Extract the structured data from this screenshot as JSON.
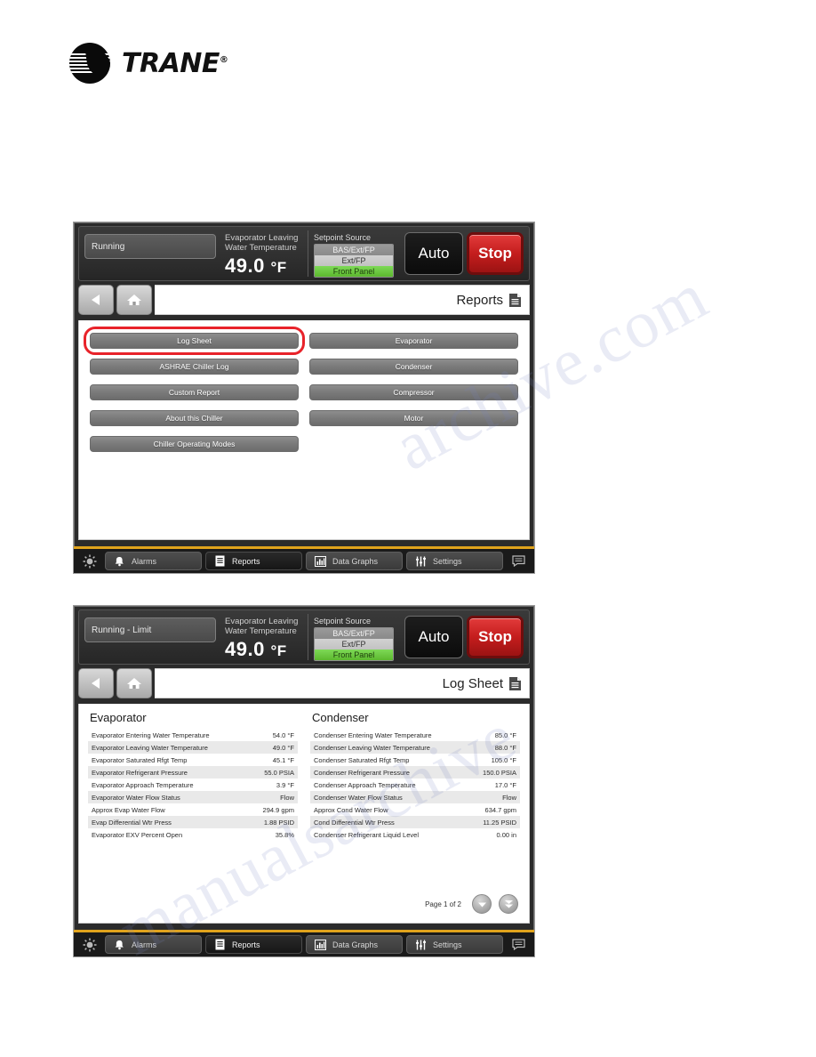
{
  "brand": {
    "name": "TRANE",
    "registered": "®"
  },
  "panel_reports": {
    "status": {
      "chiller_state": "Running",
      "temp_label": "Evaporator Leaving Water Temperature",
      "temp_value": "49.0",
      "temp_unit": "°F",
      "setpoint_title": "Setpoint Source",
      "setpoint_options": [
        {
          "label": "BAS/Ext/FP",
          "state": "gray"
        },
        {
          "label": "Ext/FP",
          "state": "light"
        },
        {
          "label": "Front Panel",
          "state": "green"
        }
      ],
      "auto_label": "Auto",
      "stop_label": "Stop"
    },
    "nav": {
      "title": "Reports"
    },
    "buttons": [
      {
        "label": "Log Sheet",
        "highlighted": true
      },
      {
        "label": "Evaporator",
        "highlighted": false
      },
      {
        "label": "ASHRAE Chiller Log",
        "highlighted": false
      },
      {
        "label": "Condenser",
        "highlighted": false
      },
      {
        "label": "Custom Report",
        "highlighted": false
      },
      {
        "label": "Compressor",
        "highlighted": false
      },
      {
        "label": "About this Chiller",
        "highlighted": false
      },
      {
        "label": "Motor",
        "highlighted": false
      },
      {
        "label": "Chiller Operating Modes",
        "highlighted": false
      }
    ]
  },
  "panel_logsheet": {
    "status": {
      "chiller_state": "Running - Limit",
      "temp_label": "Evaporator Leaving Water Temperature",
      "temp_value": "49.0",
      "temp_unit": "°F",
      "setpoint_title": "Setpoint Source",
      "setpoint_options": [
        {
          "label": "BAS/Ext/FP",
          "state": "gray"
        },
        {
          "label": "Ext/FP",
          "state": "light"
        },
        {
          "label": "Front Panel",
          "state": "green"
        }
      ],
      "auto_label": "Auto",
      "stop_label": "Stop"
    },
    "nav": {
      "title": "Log Sheet"
    },
    "evaporator": {
      "heading": "Evaporator",
      "rows": [
        {
          "name": "Evaporator Entering Water Temperature",
          "value": "54.0 °F"
        },
        {
          "name": "Evaporator Leaving Water Temperature",
          "value": "49.0 °F"
        },
        {
          "name": "Evaporator Saturated Rfgt Temp",
          "value": "45.1 °F"
        },
        {
          "name": "Evaporator Refrigerant Pressure",
          "value": "55.0 PSIA"
        },
        {
          "name": "Evaporator Approach Temperature",
          "value": "3.9 °F"
        },
        {
          "name": "Evaporator Water Flow Status",
          "value": "Flow"
        },
        {
          "name": "Approx Evap Water Flow",
          "value": "294.9 gpm"
        },
        {
          "name": "Evap Differential Wtr Press",
          "value": "1.88 PSID"
        },
        {
          "name": "Evaporator EXV Percent Open",
          "value": "35.8%"
        }
      ]
    },
    "condenser": {
      "heading": "Condenser",
      "rows": [
        {
          "name": "Condenser Entering Water Temperature",
          "value": "85.0 °F"
        },
        {
          "name": "Condenser Leaving Water Temperature",
          "value": "88.0 °F"
        },
        {
          "name": "Condenser Saturated Rfgt Temp",
          "value": "105.0 °F"
        },
        {
          "name": "Condenser Refrigerant Pressure",
          "value": "150.0 PSIA"
        },
        {
          "name": "Condenser Approach Temperature",
          "value": "17.0 °F"
        },
        {
          "name": "Condenser Water Flow Status",
          "value": "Flow"
        },
        {
          "name": "Approx Cond Water Flow",
          "value": "634.7 gpm"
        },
        {
          "name": "Cond Differential Wtr Press",
          "value": "11.25 PSID"
        },
        {
          "name": "Condenser Refrigerant Liquid Level",
          "value": "0.00 in"
        }
      ]
    },
    "pager": {
      "label": "Page 1 of 2"
    }
  },
  "toolbar": {
    "alarms": "Alarms",
    "reports": "Reports",
    "data_graphs": "Data Graphs",
    "settings": "Settings"
  },
  "colors": {
    "accent_green": "#6cc24a",
    "stop_red": "#c41d1d",
    "annotation_red": "#e8232a",
    "toolbar_gold": "#e0a31c"
  },
  "watermark": {
    "line1": "archive.com",
    "line2": "manualsarchive"
  }
}
